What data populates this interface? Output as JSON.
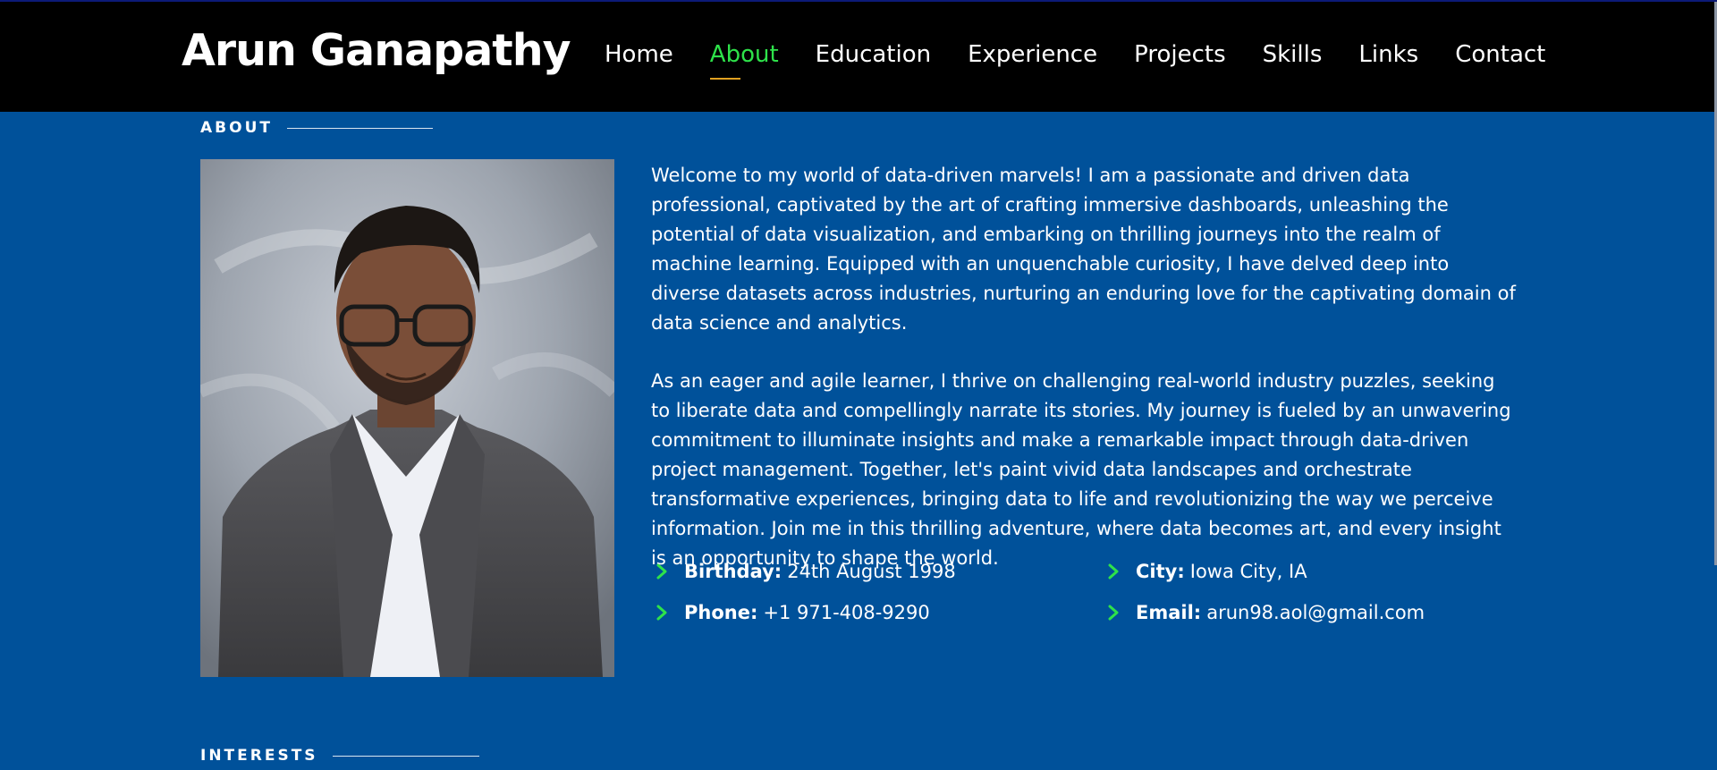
{
  "header": {
    "logo": "Arun Ganapathy",
    "nav": [
      {
        "label": "Home",
        "active": false
      },
      {
        "label": "About",
        "active": true
      },
      {
        "label": "Education",
        "active": false
      },
      {
        "label": "Experience",
        "active": false
      },
      {
        "label": "Projects",
        "active": false
      },
      {
        "label": "Skills",
        "active": false
      },
      {
        "label": "Links",
        "active": false
      },
      {
        "label": "Contact",
        "active": false
      }
    ]
  },
  "about": {
    "title": "ABOUT",
    "paragraphs": [
      "Welcome to my world of data-driven marvels! I am a passionate and driven data professional, captivated by the art of crafting immersive dashboards, unleashing the potential of data visualization, and embarking on thrilling journeys into the realm of machine learning. Equipped with an unquenchable curiosity, I have delved deep into diverse datasets across industries, nurturing an enduring love for the captivating domain of data science and analytics.",
      "As an eager and agile learner, I thrive on challenging real-world industry puzzles, seeking to liberate data and compellingly narrate its stories. My journey is fueled by an unwavering commitment to illuminate insights and make a remarkable impact through data-driven project management. Together, let's paint vivid data landscapes and orchestrate transformative experiences, bringing data to life and revolutionizing the way we perceive information. Join me in this thrilling adventure, where data becomes art, and every insight is an opportunity to shape the world."
    ],
    "info": [
      {
        "label": "Birthday:",
        "value": "24th August 1998"
      },
      {
        "label": "City:",
        "value": "Iowa City, IA"
      },
      {
        "label": "Phone:",
        "value": "+1 971-408-9290"
      },
      {
        "label": "Email:",
        "value": "arun98.aol@gmail.com"
      }
    ]
  },
  "interests": {
    "title": "INTERESTS"
  },
  "colors": {
    "page_bg": "#00519a",
    "header_bg": "#000000",
    "accent_green": "#2ee24a",
    "active_underline": "#e0a021"
  },
  "icons": {
    "info_bullet": "chevron-right-icon"
  }
}
